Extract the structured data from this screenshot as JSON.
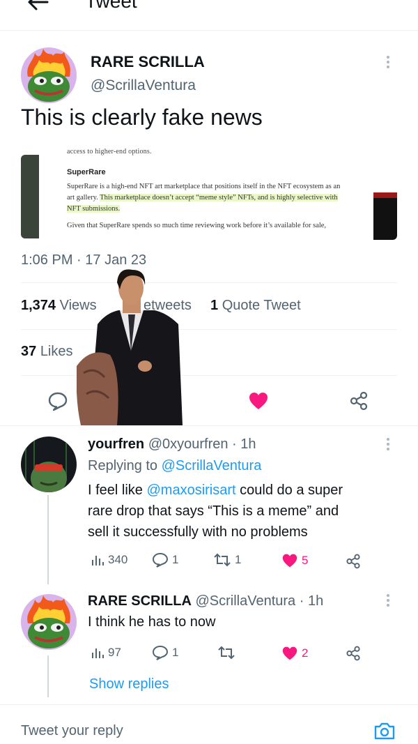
{
  "header": {
    "title": "Tweet"
  },
  "tweet": {
    "author_name": "RARE SCRILLA",
    "author_handle": "@ScrillaVentura",
    "text": "This is clearly fake news",
    "media": {
      "cut_line": "access to higher-end options.",
      "heading": "SuperRare",
      "para_a": "SuperRare is a high-end NFT art marketplace that positions itself in the NFT ecosystem as an art gallery. ",
      "para_hl": "This marketplace doesn’t accept “meme style” NFTs, and is highly selective with NFT submissions.",
      "para2": "Given that SuperRare spends so much time reviewing work before it’s available for sale,"
    },
    "time": "1:06 PM",
    "date": "17 Jan 23",
    "views_count": "1,374",
    "views_label": "Views",
    "retweets_label": "etweets",
    "quotes_count": "1",
    "quotes_label": "Quote Tweet",
    "likes_count": "37",
    "likes_label": "Likes"
  },
  "replies": [
    {
      "name": "yourfren",
      "handle": "@0xyourfren",
      "age": "1h",
      "replying_prefix": "Replying to ",
      "replying_to": "@ScrillaVentura",
      "line1_a": "I feel like ",
      "line1_mention": "@maxosirisart",
      "line1_b": " could do a super",
      "line2": "rare drop that says “This is a meme” and",
      "line3": "sell it successfully with no problems",
      "views": "340",
      "comments": "1",
      "retweets": "1",
      "likes": "5"
    },
    {
      "name": "RARE SCRILLA",
      "handle": "@ScrillaVentura",
      "age": "1h",
      "text": "I think he has to now",
      "views": "97",
      "comments": "1",
      "retweets": "",
      "likes": "2"
    }
  ],
  "show_replies": "Show replies",
  "reply_placeholder": "Tweet your reply",
  "colors": {
    "accent": "#1d9bf0",
    "like": "#f91880",
    "muted": "#536471"
  }
}
